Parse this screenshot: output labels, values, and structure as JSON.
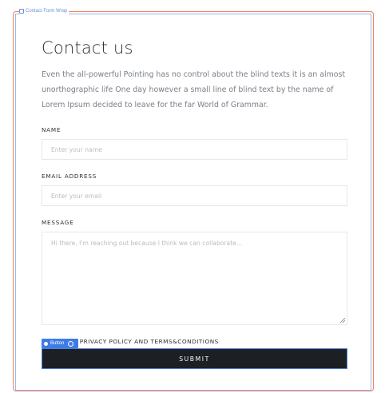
{
  "editor": {
    "frame_label": "Contact Form Wrap",
    "button_chip_label": "Button"
  },
  "form": {
    "title": "Contact us",
    "intro": "Even the all-powerful Pointing has no control about the blind texts it is an almost unorthographic life One day however a small line of blind text by the name of Lorem Ipsum decided to leave for the far World of Grammar.",
    "name_label": "NAME",
    "name_placeholder": "Enter your name",
    "email_label": "EMAIL ADDRESS",
    "email_placeholder": "Enter your email",
    "message_label": "MESSAGE",
    "message_placeholder": "Hi there, I'm reaching out because I think we can collaborate...",
    "accept_text": "T PRIVACY POLICY AND TERMS&CONDITIONS",
    "submit_label": "SUBMIT"
  },
  "colors": {
    "outer_frame": "#f2825f",
    "inner_frame": "#9fb8e6",
    "chip": "#3f7be8",
    "submit_bg": "#1c1f23"
  }
}
